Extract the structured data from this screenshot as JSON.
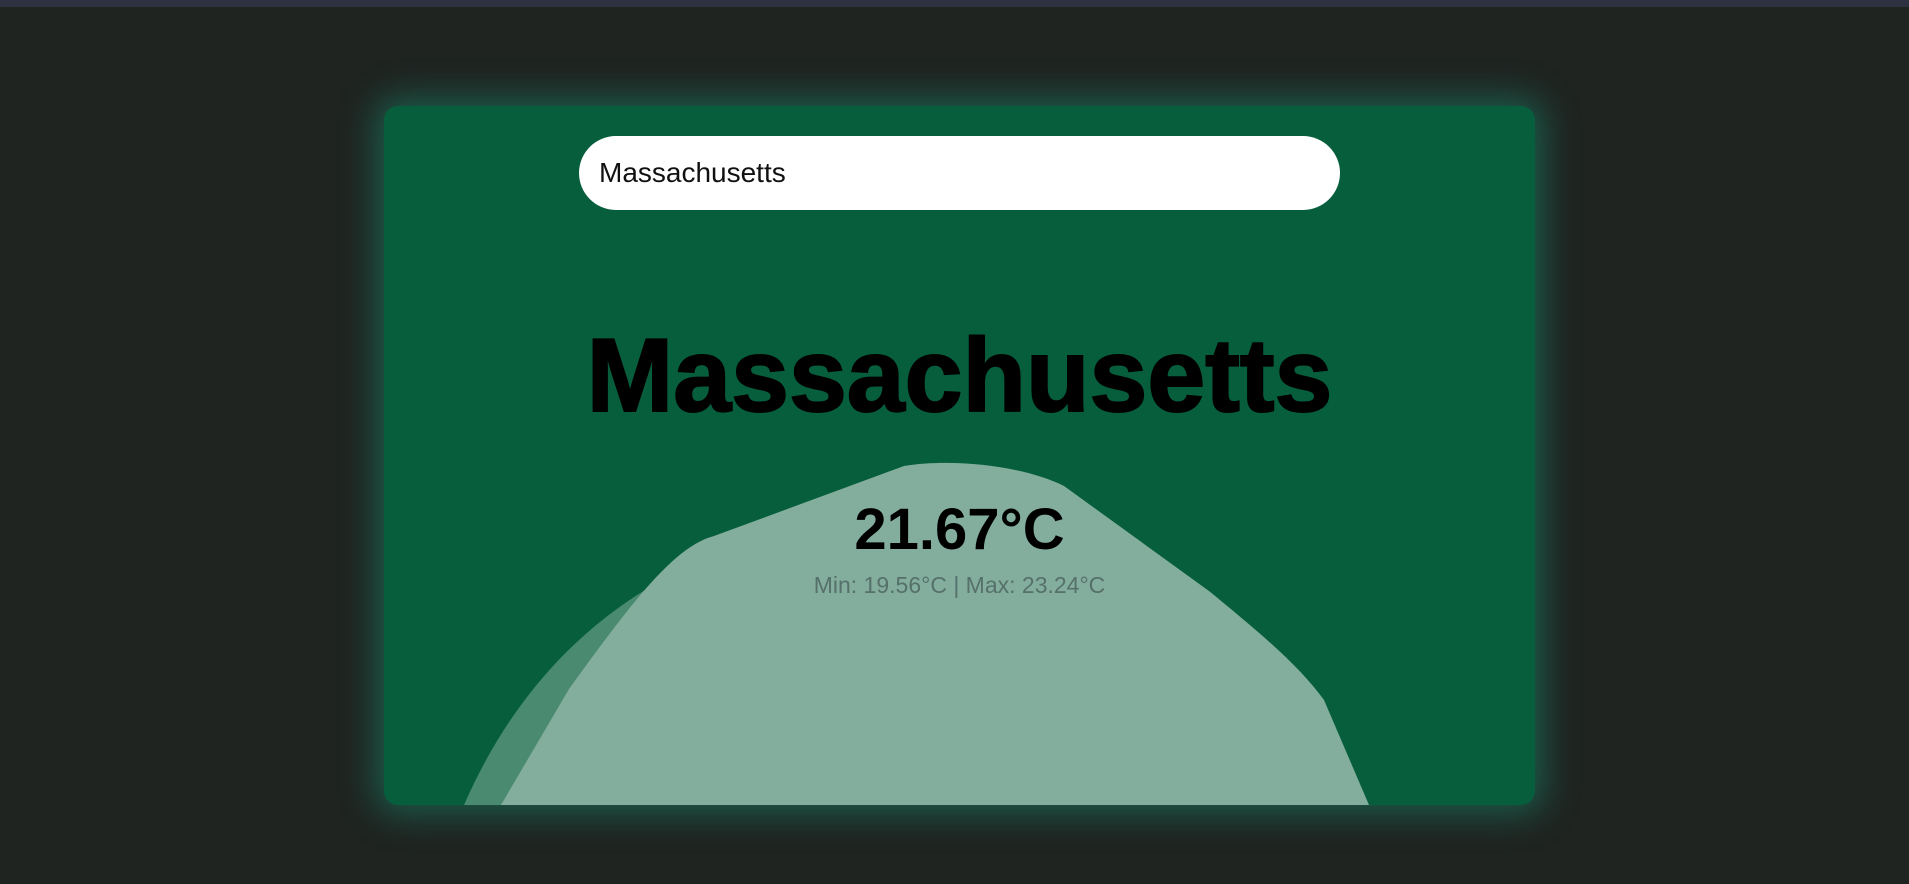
{
  "search": {
    "value": "Massachusetts",
    "placeholder": ""
  },
  "weather": {
    "city": "Massachusetts",
    "temperature": "21.67°C",
    "min_max": "Min: 19.56°C | Max: 23.24°C"
  },
  "colors": {
    "page_background": "#1f2421",
    "card_background": "#075e3d",
    "card_glow": "#1a8c70",
    "wave_dark": "#4a8a70",
    "wave_light": "#83ae9e",
    "text_primary": "#000000",
    "text_secondary": "#56706a"
  }
}
